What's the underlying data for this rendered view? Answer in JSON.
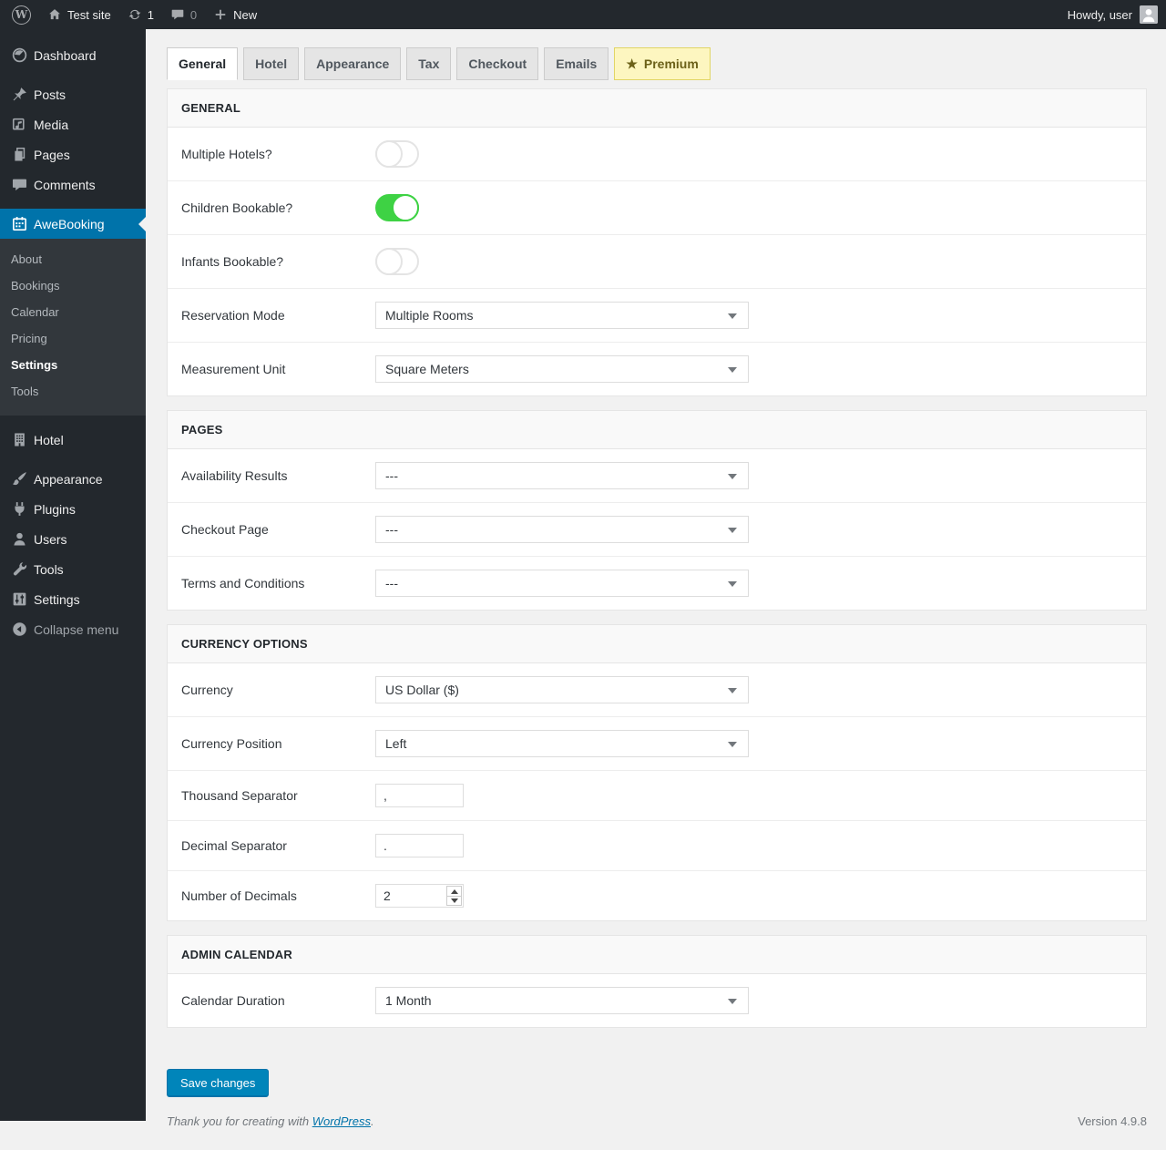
{
  "admin_bar": {
    "wp_logo": "W",
    "site_name": "Test site",
    "update_count": "1",
    "comment_count": "0",
    "new_label": "New",
    "greeting": "Howdy, user"
  },
  "sidebar": {
    "items": [
      {
        "label": "Dashboard"
      },
      {
        "label": "Posts"
      },
      {
        "label": "Media"
      },
      {
        "label": "Pages"
      },
      {
        "label": "Comments"
      },
      {
        "label": "AweBooking",
        "state": "active"
      },
      {
        "label": "Hotel"
      },
      {
        "label": "Appearance"
      },
      {
        "label": "Plugins"
      },
      {
        "label": "Users"
      },
      {
        "label": "Tools"
      },
      {
        "label": "Settings"
      }
    ],
    "awebooking_submenu": [
      "About",
      "Bookings",
      "Calendar",
      "Pricing",
      "Settings",
      "Tools"
    ],
    "awebooking_submenu_current": "Settings",
    "collapse_label": "Collapse menu"
  },
  "tabs": {
    "items": [
      {
        "label": "General",
        "state": "active"
      },
      {
        "label": "Hotel"
      },
      {
        "label": "Appearance"
      },
      {
        "label": "Tax"
      },
      {
        "label": "Checkout"
      },
      {
        "label": "Emails"
      },
      {
        "label": "Premium",
        "premium": true
      }
    ]
  },
  "settings": {
    "general": {
      "title": "GENERAL",
      "multiple_hotels": {
        "label": "Multiple Hotels?",
        "value": "off"
      },
      "children_bookable": {
        "label": "Children Bookable?",
        "value": "on"
      },
      "infants_bookable": {
        "label": "Infants Bookable?",
        "value": "off"
      },
      "reservation_mode": {
        "label": "Reservation Mode",
        "value": "Multiple Rooms"
      },
      "measurement_unit": {
        "label": "Measurement Unit",
        "value": "Square Meters"
      }
    },
    "pages": {
      "title": "PAGES",
      "availability_results": {
        "label": "Availability Results",
        "value": "---"
      },
      "checkout_page": {
        "label": "Checkout Page",
        "value": "---"
      },
      "terms_and_conditions": {
        "label": "Terms and Conditions",
        "value": "---"
      }
    },
    "currency_options": {
      "title": "CURRENCY OPTIONS",
      "currency": {
        "label": "Currency",
        "value": "US Dollar ($)"
      },
      "currency_position": {
        "label": "Currency Position",
        "value": "Left"
      },
      "thousand_separator": {
        "label": "Thousand Separator",
        "value": ","
      },
      "decimal_separator": {
        "label": "Decimal Separator",
        "value": "."
      },
      "number_of_decimals": {
        "label": "Number of Decimals",
        "value": "2"
      }
    },
    "admin_calendar": {
      "title": "ADMIN CALENDAR",
      "calendar_duration": {
        "label": "Calendar Duration",
        "value": "1 Month"
      }
    },
    "save_label": "Save changes"
  },
  "footer": {
    "thanks_text": "Thank you for creating with",
    "link": "WordPress",
    "suffix": ".",
    "version": "Version 4.9.8"
  },
  "colors": {
    "admin_dark": "#23282d",
    "submenu_dark": "#32373c",
    "accent_blue": "#0073aa",
    "button_blue": "#0085ba",
    "toggle_on_green": "#3ed244",
    "premium_bg": "#fdf6c0",
    "premium_border": "#e1d565",
    "page_bg": "#f1f1f1"
  }
}
